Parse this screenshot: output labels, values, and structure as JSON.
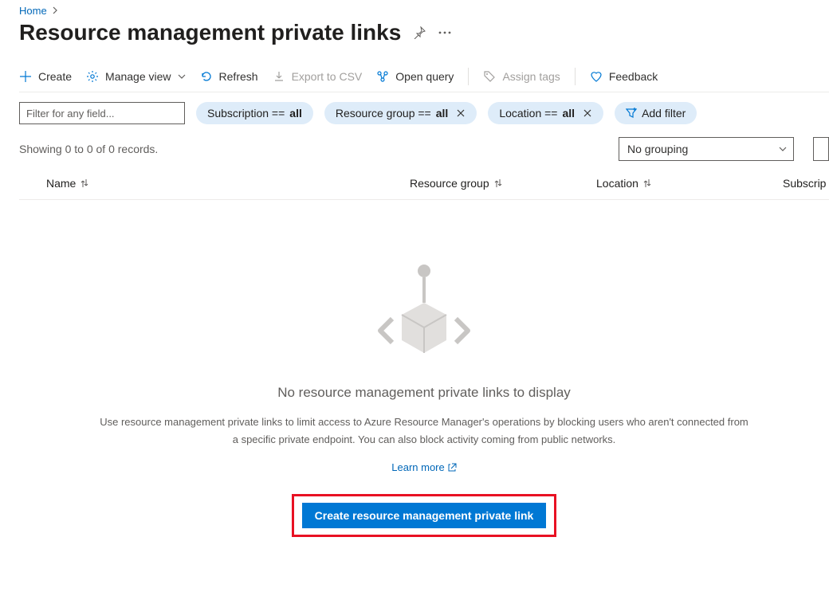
{
  "breadcrumb": {
    "home": "Home"
  },
  "page_title": "Resource management private links",
  "toolbar": {
    "create": "Create",
    "manage_view": "Manage view",
    "refresh": "Refresh",
    "export_csv": "Export to CSV",
    "open_query": "Open query",
    "assign_tags": "Assign tags",
    "feedback": "Feedback"
  },
  "filters": {
    "text_placeholder": "Filter for any field...",
    "subscription_prefix": "Subscription == ",
    "subscription_value": "all",
    "rg_prefix": "Resource group == ",
    "rg_value": "all",
    "location_prefix": "Location == ",
    "location_value": "all",
    "add_filter": "Add filter"
  },
  "status": {
    "record_text": "Showing 0 to 0 of 0 records.",
    "grouping": "No grouping"
  },
  "columns": {
    "name": "Name",
    "resource_group": "Resource group",
    "location": "Location",
    "subscription": "Subscrip"
  },
  "empty": {
    "heading": "No resource management private links to display",
    "body": "Use resource management private links to limit access to Azure Resource Manager's operations by blocking users who aren't connected from a specific private endpoint. You can also block activity coming from public networks.",
    "learn_more": "Learn more",
    "cta": "Create resource management private link"
  }
}
